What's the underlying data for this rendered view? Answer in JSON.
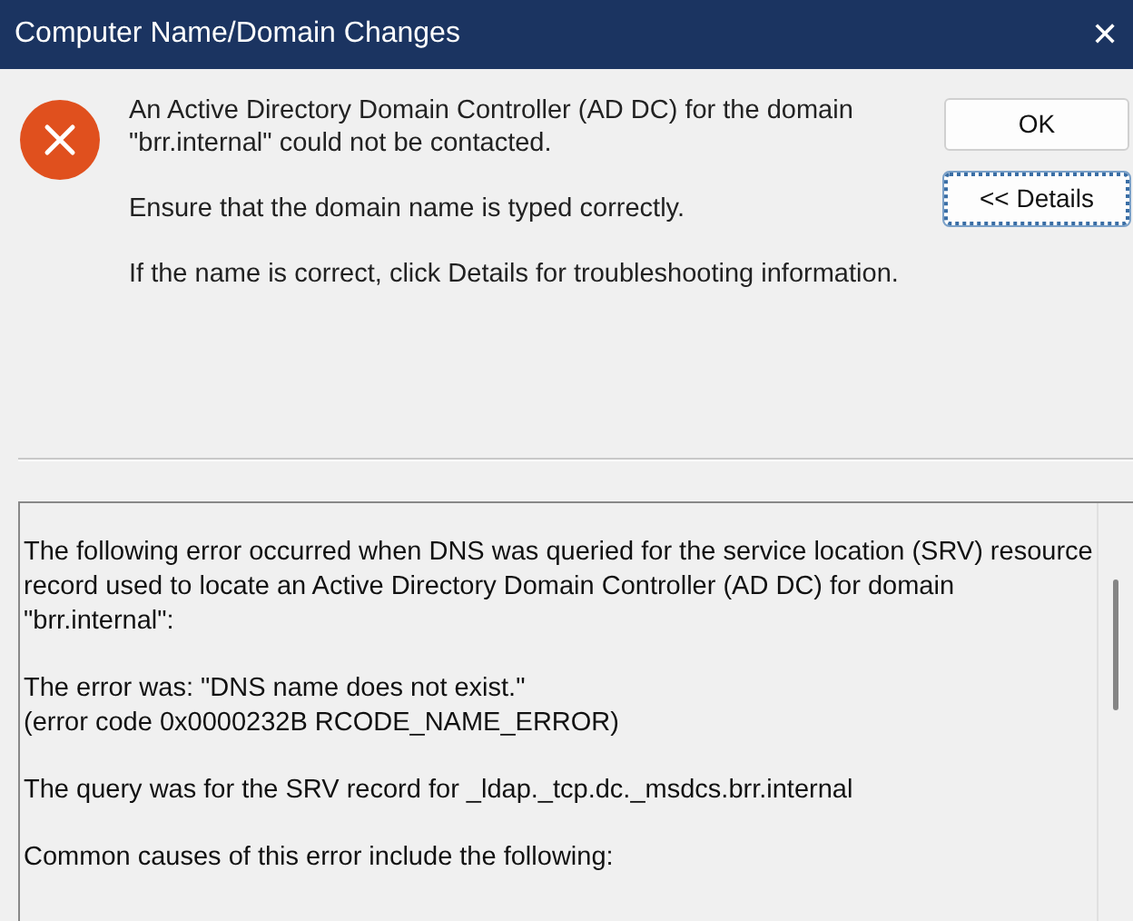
{
  "window": {
    "title": "Computer Name/Domain Changes",
    "close": "✕"
  },
  "message": [
    "An Active Directory Domain Controller (AD DC) for the domain \"brr.internal\" could not be contacted.",
    "Ensure that the domain name is typed correctly.",
    "If the name is correct, click Details for troubleshooting information."
  ],
  "buttons": [
    {
      "label": "OK",
      "focused": false
    },
    {
      "label": "<< Details",
      "focused": true
    }
  ],
  "details": [
    [
      "The following error occurred when DNS was queried for the service location (SRV) resource record used to locate an Active Directory Domain Controller (AD DC) for domain \"brr.internal\":"
    ],
    [
      "The error was: \"DNS name does not exist.\"",
      "(error code 0x0000232B RCODE_NAME_ERROR)"
    ],
    [
      "The query was for the SRV record for _ldap._tcp.dc._msdcs.brr.internal"
    ],
    [
      "Common causes of this error include the following:"
    ]
  ]
}
